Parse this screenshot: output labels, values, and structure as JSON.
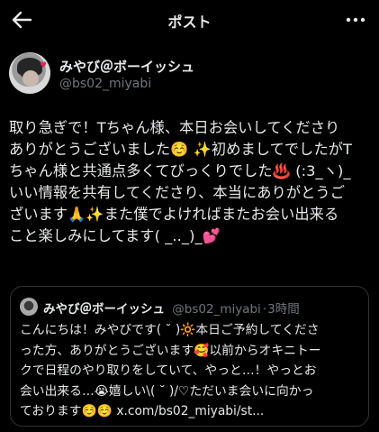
{
  "header": {
    "title": "ポスト",
    "back_icon": "arrow-left-icon",
    "more_icon": "more-horizontal-icon"
  },
  "post": {
    "display_name": "みやび＠ボーイッシュ",
    "handle": "@bs02_miyabi",
    "text": "取り急ぎで！Tちゃん様、本日お会いしてくださり\nありがとうございました☺️ ✨初めましてでしたがT\nちゃん様と共通点多くてびっくりでした♨️ (:3_ヽ)_\nいい情報を共有してくださり、本当にありがとうご\nざいます🙏✨また僕でよければまたお会い出来る\nこと楽しみにしてます( _.._)_💕"
  },
  "quoted_post": {
    "display_name": "みやび＠ボーイッシュ",
    "handle": "@bs02_miyabi",
    "separator": "·",
    "time": "3時間",
    "text": "こんにちは！みやびです( ˘ )🔆本日ご予約してくださ\nった方、ありがとうございます🥰以前からオキニトー\nクで日程のやり取りをしていて、やっと…！やっとお\n会い出来る…😭嬉しい\\( ˘ )/♡ただいま会いに向かっ\nております☺️☺️ x.com/bs02_miyabi/st..."
  },
  "colors": {
    "background": "#000000",
    "text": "#e7e9ea",
    "secondary_text": "#71767b",
    "border": "#2f3336"
  }
}
